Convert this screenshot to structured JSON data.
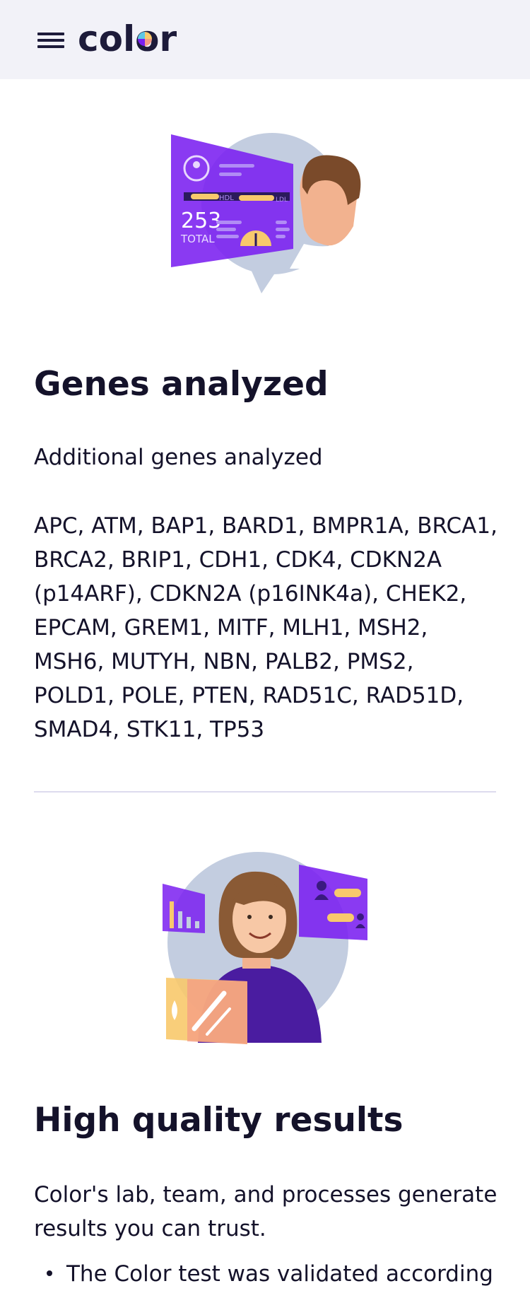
{
  "header": {
    "logo_text": "color",
    "menu_icon": "hamburger-menu-icon"
  },
  "section_genes": {
    "illustration": "cholesterol-dashboard-illustration",
    "illustration_labels": {
      "hdl": "HDL",
      "ldl": "LDL",
      "total_value": "253",
      "total_label": "TOTAL"
    },
    "title": "Genes analyzed",
    "subtitle": "Additional genes analyzed",
    "genes_list": "APC, ATM, BAP1, BARD1, BMPR1A, BRCA1, BRCA2, BRIP1, CDH1, CDK4, CDKN2A (p14ARF), CDKN2A (p16INK4a), CHEK2, EPCAM, GREM1, MITF, MLH1, MSH2, MSH6, MUTYH, NBN, PALB2, PMS2, POLD1, POLE, PTEN, RAD51C, RAD51D, SMAD4, STK11, TP53"
  },
  "section_quality": {
    "illustration": "smiling-woman-lab-illustration",
    "title": "High quality results",
    "lead": "Color's lab, team, and processes generate results you can trust.",
    "bullets": [
      "The Color test was validated according"
    ]
  },
  "colors": {
    "header_bg": "#f2f2f8",
    "text": "#14122a",
    "purple": "#7a1ff0",
    "blue_grey": "#c3cde0",
    "yellow": "#f8c96c",
    "salmon": "#f49b86",
    "divider": "#dddbee"
  }
}
